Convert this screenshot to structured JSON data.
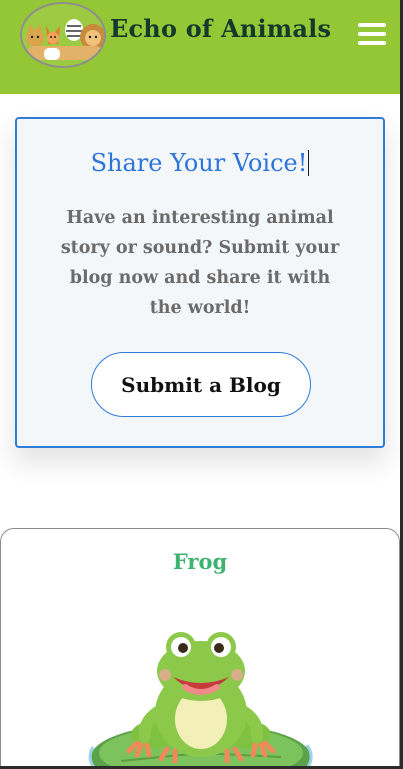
{
  "header": {
    "brand": "Echo of Animals",
    "logo_icon": "animals-logo-icon",
    "menu_icon": "hamburger-menu-icon",
    "background_color": "#94c735"
  },
  "share": {
    "title": "Share Your Voice!",
    "text": "Have an interesting animal story or sound? Submit your blog now and share it with the world!",
    "button_label": "Submit a Blog",
    "accent_color": "#2f7bd7"
  },
  "animal_card": {
    "name": "Frog",
    "image_icon": "frog-on-lily-pad-icon",
    "name_color": "#3cb371"
  }
}
